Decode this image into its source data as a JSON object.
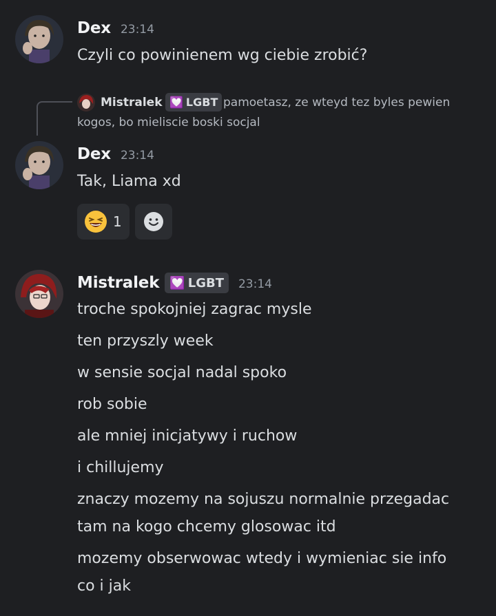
{
  "messages": [
    {
      "author": "Dex",
      "time": "23:14",
      "lines": [
        "Czyli co powinienem wg ciebie zrobić?"
      ]
    },
    {
      "author": "Dex",
      "time": "23:14",
      "reply": {
        "author": "Mistralek",
        "tag": "LGBT",
        "text_line1": "pamoetasz, ze wteyd tez byles pewien",
        "text_line2": "kogos, bo mieliscie boski socjal"
      },
      "lines": [
        "Tak, Liama xd"
      ],
      "reactions": [
        {
          "emoji": "laughing-emoji",
          "count": "1"
        }
      ]
    },
    {
      "author": "Mistralek",
      "tag": "LGBT",
      "time": "23:14",
      "lines": [
        "troche spokojniej zagrac mysle",
        "ten przyszly week",
        "w sensie socjal nadal spoko",
        "rob sobie",
        "ale mniej inicjatywy i ruchow",
        "i chillujemy",
        "znaczy mozemy na sojuszu normalnie przegadac",
        "tam na kogo chcemy glosowac itd",
        "mozemy obserwowac wtedy i wymieniac sie info",
        "co i jak"
      ]
    }
  ],
  "colors": {
    "background": "#1e1f22",
    "text": "#dbdee1",
    "muted": "#949ba4",
    "tag_heart": "#e78ef2"
  }
}
